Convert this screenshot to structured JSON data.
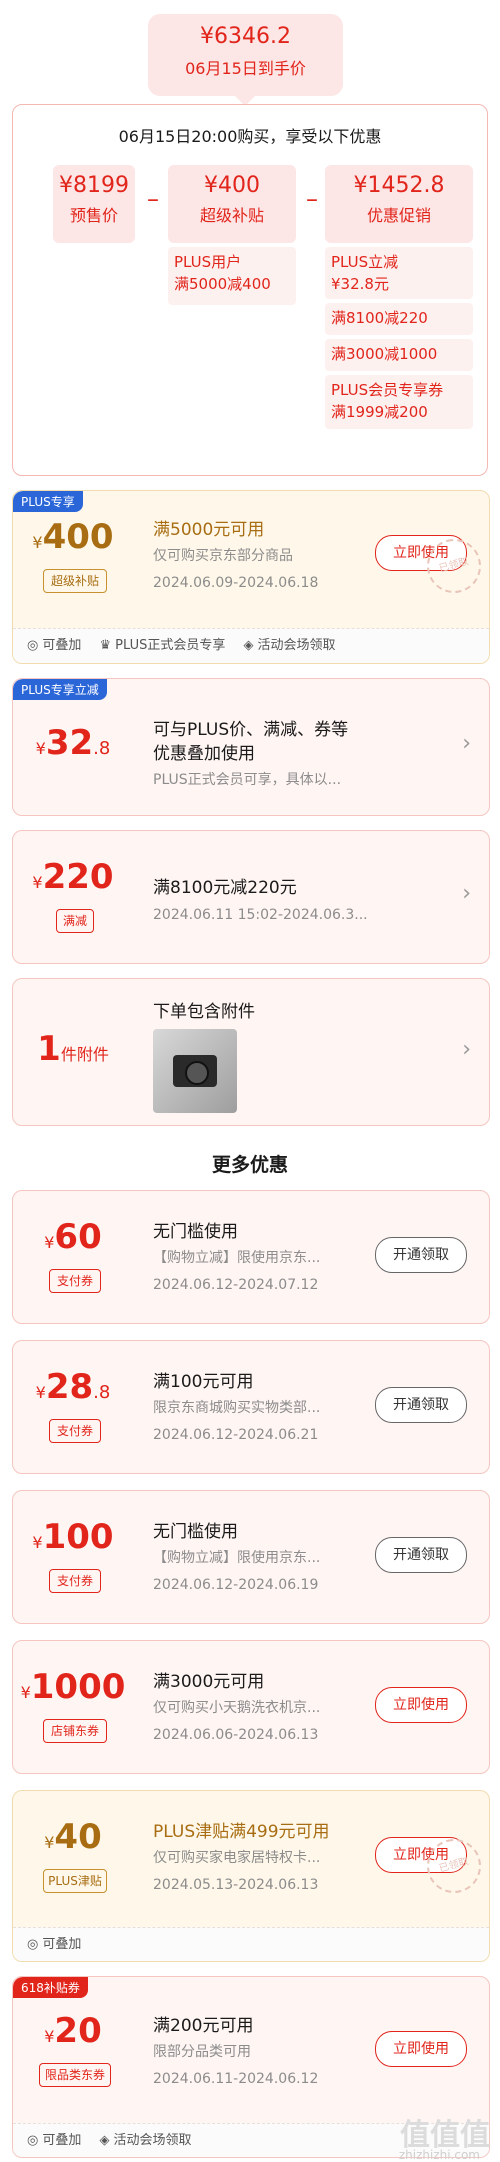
{
  "summary": {
    "price": "¥6346.2",
    "date_label": "06月15日到手价"
  },
  "breakdown": {
    "header": "06月15日20:00购买，享受以下优惠",
    "presale": {
      "value": "¥8199",
      "label": "预售价"
    },
    "subsidy": {
      "value": "¥400",
      "label": "超级补贴",
      "note": "PLUS用户\n满5000减400"
    },
    "promo": {
      "value": "¥1452.8",
      "label": "优惠促销"
    },
    "promo_items": [
      "PLUS立减\n¥32.8元",
      "满8100减220",
      "满3000减1000",
      "PLUS会员专享券\n满1999减200"
    ]
  },
  "cards": [
    {
      "corner": "PLUS专享",
      "cur": "¥",
      "amount": "400",
      "tag": "超级补贴",
      "title": "满5000元可用",
      "line2": "仅可购买京东部分商品",
      "line3": "2024.06.09-2024.06.18",
      "button": "立即使用",
      "stamp": "已领取",
      "foot": [
        "可叠加",
        "PLUS正式会员专享",
        "活动会场领取"
      ]
    },
    {
      "corner": "PLUS专享立减",
      "cur": "¥",
      "amount": "32",
      "dec": ".8",
      "title": "可与PLUS价、满减、券等",
      "title2": "优惠叠加使用",
      "line3": "PLUS正式会员可享，具体以..."
    },
    {
      "cur": "¥",
      "amount": "220",
      "tag": "满减",
      "title": "满8100元减220元",
      "line3": "2024.06.11 15:02-2024.06.3..."
    },
    {
      "amount": "1",
      "unit": "件附件",
      "title": "下单包含附件"
    }
  ],
  "more": {
    "title": "更多优惠",
    "items": [
      {
        "cur": "¥",
        "amount": "60",
        "tag": "支付券",
        "title": "无门槛使用",
        "line2": "【购物立减】限使用京东...",
        "line3": "2024.06.12-2024.07.12",
        "button": "开通领取"
      },
      {
        "cur": "¥",
        "amount": "28",
        "dec": ".8",
        "tag": "支付券",
        "title": "满100元可用",
        "line2": "限京东商城购买实物类部...",
        "line3": "2024.06.12-2024.06.21",
        "button": "开通领取"
      },
      {
        "cur": "¥",
        "amount": "100",
        "tag": "支付券",
        "title": "无门槛使用",
        "line2": "【购物立减】限使用京东...",
        "line3": "2024.06.12-2024.06.19",
        "button": "开通领取"
      },
      {
        "cur": "¥",
        "amount": "1000",
        "tag": "店铺东券",
        "title": "满3000元可用",
        "line2": "仅可购买小天鹅洗衣机京...",
        "line3": "2024.06.06-2024.06.13",
        "button": "立即使用"
      },
      {
        "cur": "¥",
        "amount": "40",
        "tag": "PLUS津贴",
        "title": "PLUS津贴满499元可用",
        "line2": "仅可购买家电家居特权卡...",
        "line3": "2024.05.13-2024.06.13",
        "button": "立即使用",
        "stamp": "已领取",
        "foot": [
          "可叠加"
        ]
      },
      {
        "corner": "618补贴券",
        "cur": "¥",
        "amount": "20",
        "tag": "限品类东券",
        "title": "满200元可用",
        "line2": "限部分品类可用",
        "line3": "2024.06.11-2024.06.12",
        "button": "立即使用",
        "foot": [
          "可叠加",
          "活动会场领取"
        ]
      }
    ]
  },
  "watermark": {
    "main": "值值值",
    "sub": "zhizhizhi.com"
  }
}
